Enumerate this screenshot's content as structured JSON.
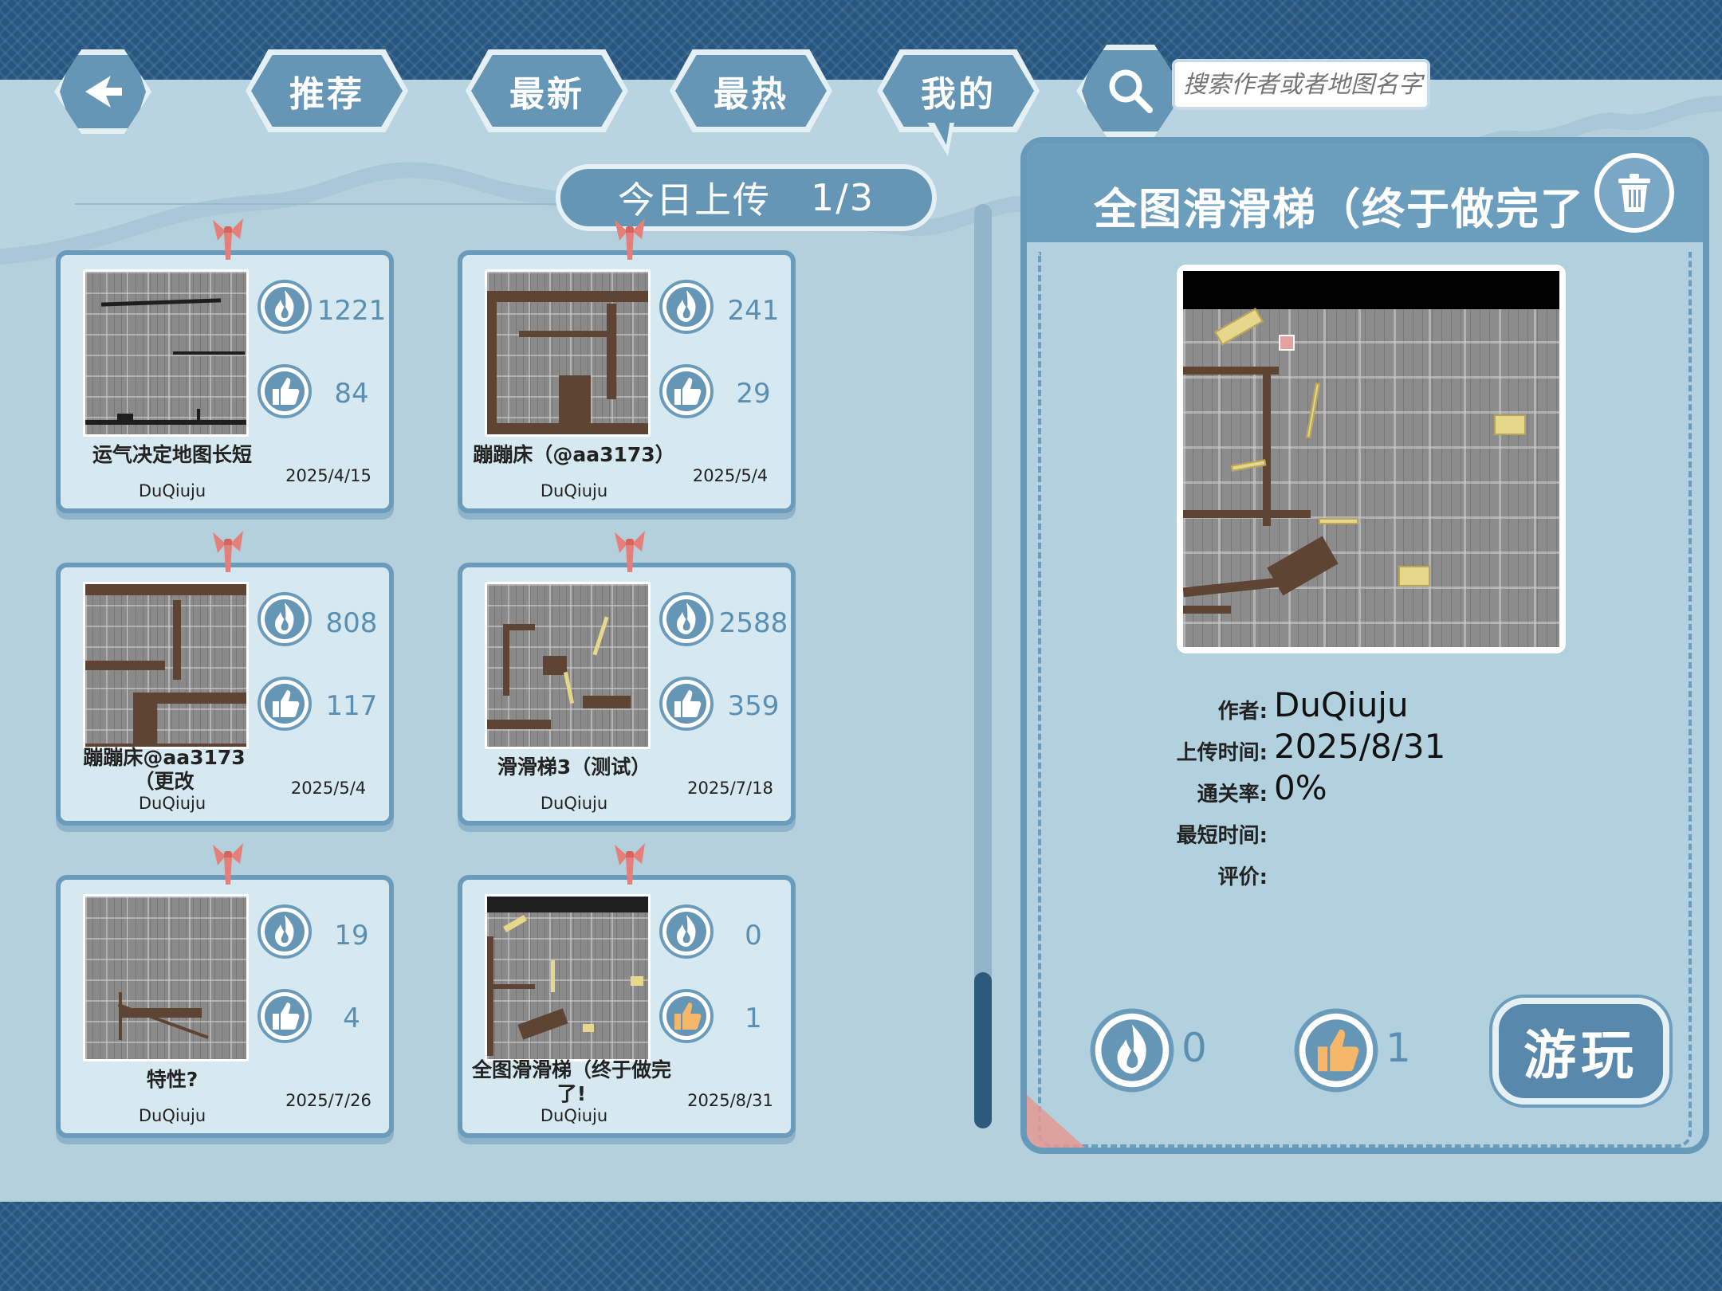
{
  "nav": {
    "back_icon": "back-arrow-icon",
    "tabs": [
      "推荐",
      "最新",
      "最热",
      "我的"
    ],
    "search_icon": "search-icon",
    "search_placeholder": "搜索作者或者地图名字"
  },
  "upload_counter": {
    "label": "今日上传",
    "value": "1/3"
  },
  "stat_icons": {
    "plays": "fire-icon",
    "likes": "thumbs-up-icon",
    "pin": "ribbon-pin-icon"
  },
  "maps": [
    {
      "title": "运气决定地图长短",
      "author": "DuQiuju",
      "date": "2025/4/15",
      "plays": "1221",
      "likes": "84",
      "liked": false
    },
    {
      "title": "蹦蹦床（@aa3173）",
      "author": "DuQiuju",
      "date": "2025/5/4",
      "plays": "241",
      "likes": "29",
      "liked": false
    },
    {
      "title": "蹦蹦床@aa3173（更改",
      "author": "DuQiuju",
      "date": "2025/5/4",
      "plays": "808",
      "likes": "117",
      "liked": false
    },
    {
      "title": "滑滑梯3（测试）",
      "author": "DuQiuju",
      "date": "2025/7/18",
      "plays": "2588",
      "likes": "359",
      "liked": false
    },
    {
      "title": "特性?",
      "author": "DuQiuju",
      "date": "2025/7/26",
      "plays": "19",
      "likes": "4",
      "liked": false
    },
    {
      "title": "全图滑滑梯（终于做完了!",
      "author": "DuQiuju",
      "date": "2025/8/31",
      "plays": "0",
      "likes": "1",
      "liked": true
    }
  ],
  "detail": {
    "title": "全图滑滑梯（终于做完了",
    "delete_icon": "trash-icon",
    "author_label": "作者:",
    "author": "DuQiuju",
    "upload_label": "上传时间:",
    "upload_time": "2025/8/31",
    "clear_rate_label": "通关率:",
    "clear_rate": "0%",
    "best_time_label": "最短时间:",
    "best_time": "",
    "rating_label": "评价:",
    "rating": "",
    "plays": "0",
    "likes": "1",
    "play_button": "游玩"
  },
  "colors": {
    "band": "#275780",
    "background": "#b4d0dd",
    "button": "#6596b6",
    "stat_number": "#5a8fb2",
    "liked_thumb": "#f5b86b",
    "ribbon": "#e57f7a"
  }
}
